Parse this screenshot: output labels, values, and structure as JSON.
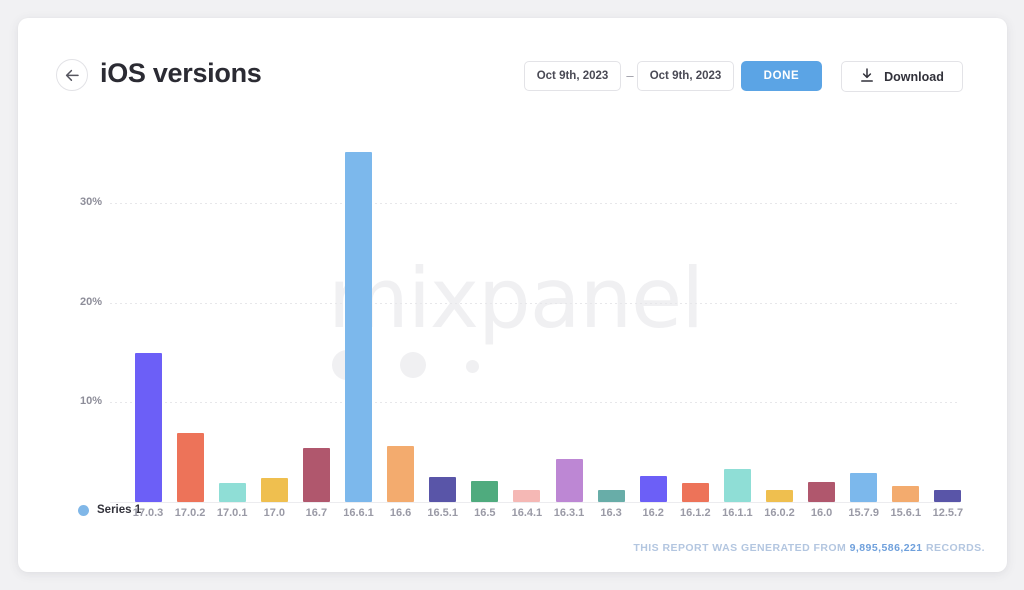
{
  "header": {
    "back_icon": "arrow-left-icon",
    "title": "iOS versions",
    "date_start": "Oct 9th, 2023",
    "date_separator": "–",
    "date_end": "Oct 9th, 2023",
    "done_label": "DONE",
    "download_label": "Download",
    "download_icon": "download-icon"
  },
  "watermark": {
    "text": "mixpanel"
  },
  "legend": {
    "series_label": "Series 1",
    "swatch_color": "#80b7e8"
  },
  "footer": {
    "prefix": "THIS REPORT WAS GENERATED FROM",
    "records": "9,895,586,221",
    "suffix": "RECORDS."
  },
  "chart_data": {
    "type": "bar",
    "title": "iOS versions",
    "xlabel": "",
    "ylabel": "",
    "ylim": [
      0,
      37
    ],
    "grid": true,
    "legend_position": "bottom-left",
    "yticks": [
      10,
      20,
      30
    ],
    "ytick_labels": [
      "10%",
      "20%",
      "30%"
    ],
    "categories": [
      "17.0.3",
      "17.0.2",
      "17.0.1",
      "17.0",
      "16.7",
      "16.6.1",
      "16.6",
      "16.5.1",
      "16.5",
      "16.4.1",
      "16.3.1",
      "16.3",
      "16.2",
      "16.1.2",
      "16.1.1",
      "16.0.2",
      "16.0",
      "15.7.9",
      "15.6.1",
      "12.5.7"
    ],
    "series": [
      {
        "name": "Series 1",
        "values": [
          15.0,
          6.9,
          1.9,
          2.4,
          5.4,
          35.1,
          5.6,
          2.5,
          2.1,
          1.2,
          4.3,
          1.2,
          2.6,
          1.9,
          3.3,
          1.2,
          2.0,
          2.9,
          1.6,
          1.2
        ]
      }
    ],
    "colors": [
      "#6c5ff7",
      "#ed7359",
      "#8fded6",
      "#efbf4f",
      "#b0576d",
      "#7cb8ec",
      "#f3ab6e",
      "#5955a8",
      "#4fab7e",
      "#f5b8b5",
      "#bd87d4",
      "#68ada8",
      "#6c5ff7",
      "#ed7359",
      "#8fded6",
      "#efbf4f",
      "#b0576d",
      "#7cb8ec",
      "#f3ab6e",
      "#5955a8"
    ]
  }
}
